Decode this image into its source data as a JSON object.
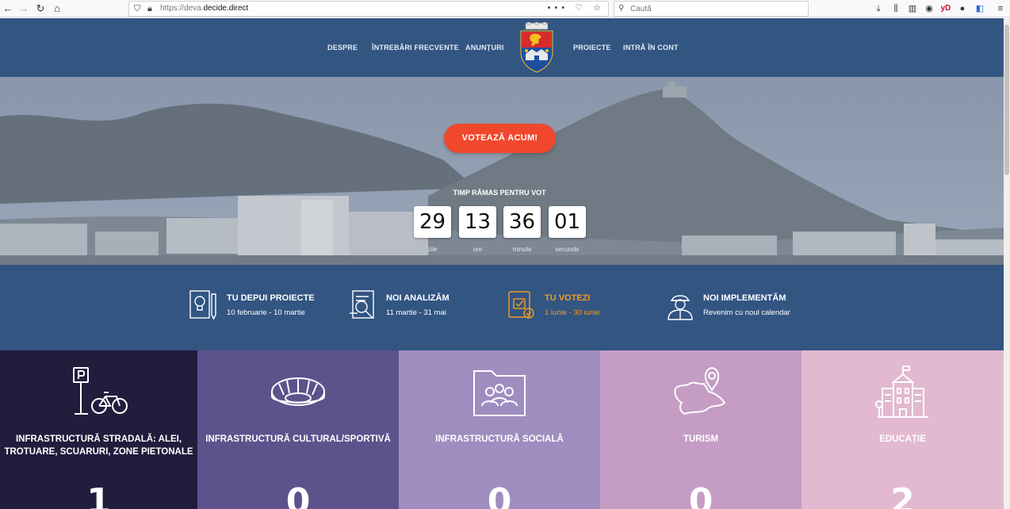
{
  "browser": {
    "url_prefix": "https://deva.",
    "url_domain": "decide.direct",
    "search_placeholder": "Caută",
    "url_actions": "••• ♡ ☆"
  },
  "nav": {
    "items": [
      "DESPRE",
      "ÎNTREBĂRI FRECVENTE",
      "ANUNȚURI",
      "PROIECTE",
      "INTRĂ ÎN CONT"
    ]
  },
  "hero": {
    "vote_label": "VOTEAZĂ ACUM!",
    "timer_label": "TIMP RĂMAS PENTRU VOT",
    "timer": [
      {
        "value": "29",
        "unit": "zile"
      },
      {
        "value": "13",
        "unit": "ore"
      },
      {
        "value": "36",
        "unit": "minute"
      },
      {
        "value": "01",
        "unit": "secunde"
      }
    ]
  },
  "steps": [
    {
      "title": "TU DEPUI PROIECTE",
      "date": "10 februarie - 10 martie",
      "icon": "idea-pencil-icon",
      "active": false
    },
    {
      "title": "NOI ANALIZĂM",
      "date": "11 martie - 31 mai",
      "icon": "magnifier-document-icon",
      "active": false
    },
    {
      "title": "TU VOTEZI",
      "date": "1 iunie - 30 iunie",
      "icon": "vote-check-icon",
      "active": true
    },
    {
      "title": "NOI IMPLEMENTĂM",
      "date": "Revenim cu noul calendar",
      "icon": "worker-helmet-icon",
      "active": false
    }
  ],
  "categories": [
    {
      "title": "INFRASTRUCTURĂ STRADALĂ: ALEI, TROTUARE, SCUARURI, ZONE PIETONALE",
      "count": "1",
      "color": "#221c3d",
      "icon": "parking-bicycle-icon"
    },
    {
      "title": "INFRASTRUCTURĂ CULTURAL/SPORTIVĂ",
      "count": "0",
      "color": "#5d528c",
      "icon": "stadium-icon"
    },
    {
      "title": "INFRASTRUCTURĂ SOCIALĂ",
      "count": "0",
      "color": "#9f8dc0",
      "icon": "people-folder-icon"
    },
    {
      "title": "TURISM",
      "count": "0",
      "color": "#c49cc4",
      "icon": "map-pin-icon"
    },
    {
      "title": "EDUCAȚIE",
      "count": "2",
      "color": "#e2b9d0",
      "icon": "school-building-icon"
    }
  ],
  "colors": {
    "header_bg": "#325582",
    "vote_button": "#f0482d",
    "active_step": "#f39b23"
  }
}
